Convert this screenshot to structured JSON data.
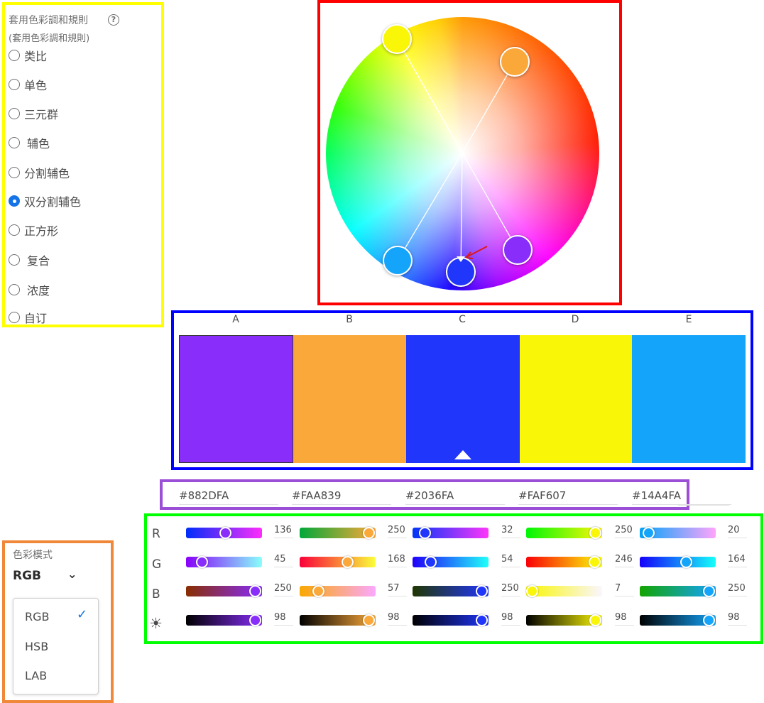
{
  "harmony": {
    "title": "套用色彩調和規則",
    "subtitle": "(套用色彩調和規則)",
    "help_icon": "?",
    "rules": [
      {
        "label": "类比",
        "checked": false
      },
      {
        "label": "单色",
        "checked": false
      },
      {
        "label": "三元群",
        "checked": false
      },
      {
        "label": "辅色",
        "checked": false
      },
      {
        "label": "分割辅色",
        "checked": false
      },
      {
        "label": "双分割辅色",
        "checked": true
      },
      {
        "label": "正方形",
        "checked": false
      },
      {
        "label": "复合",
        "checked": false
      },
      {
        "label": "浓度",
        "checked": false
      },
      {
        "label": "自订",
        "checked": false
      }
    ]
  },
  "swatches": [
    {
      "letter": "A",
      "hex": "#882DFA"
    },
    {
      "letter": "B",
      "hex": "#FAA839"
    },
    {
      "letter": "C",
      "hex": "#2036FA"
    },
    {
      "letter": "D",
      "hex": "#FAF607"
    },
    {
      "letter": "E",
      "hex": "#14A4FA"
    }
  ],
  "rows": {
    "labels": [
      "R",
      "G",
      "B"
    ],
    "brightness_icon": "☀"
  },
  "channels": [
    {
      "r": 136,
      "g": 45,
      "b": 250,
      "brightness": 98
    },
    {
      "r": 250,
      "g": 168,
      "b": 57,
      "brightness": 98
    },
    {
      "r": 32,
      "g": 54,
      "b": 250,
      "brightness": 98
    },
    {
      "r": 250,
      "g": 246,
      "b": 7,
      "brightness": 98
    },
    {
      "r": 20,
      "g": 164,
      "b": 250,
      "brightness": 98
    }
  ],
  "color_mode": {
    "title": "色彩模式",
    "selected": "RGB",
    "chevron": "⌄",
    "check": "✓",
    "options": [
      "RGB",
      "HSB",
      "LAB"
    ]
  },
  "colors": {
    "highlight_yellow": "#ffff00",
    "highlight_red": "#ff0000",
    "highlight_blue": "#0000ff",
    "highlight_purple": "#9b4ed6",
    "highlight_green": "#00ff00",
    "highlight_orange": "#f0883a",
    "accent": "#1473e6"
  }
}
